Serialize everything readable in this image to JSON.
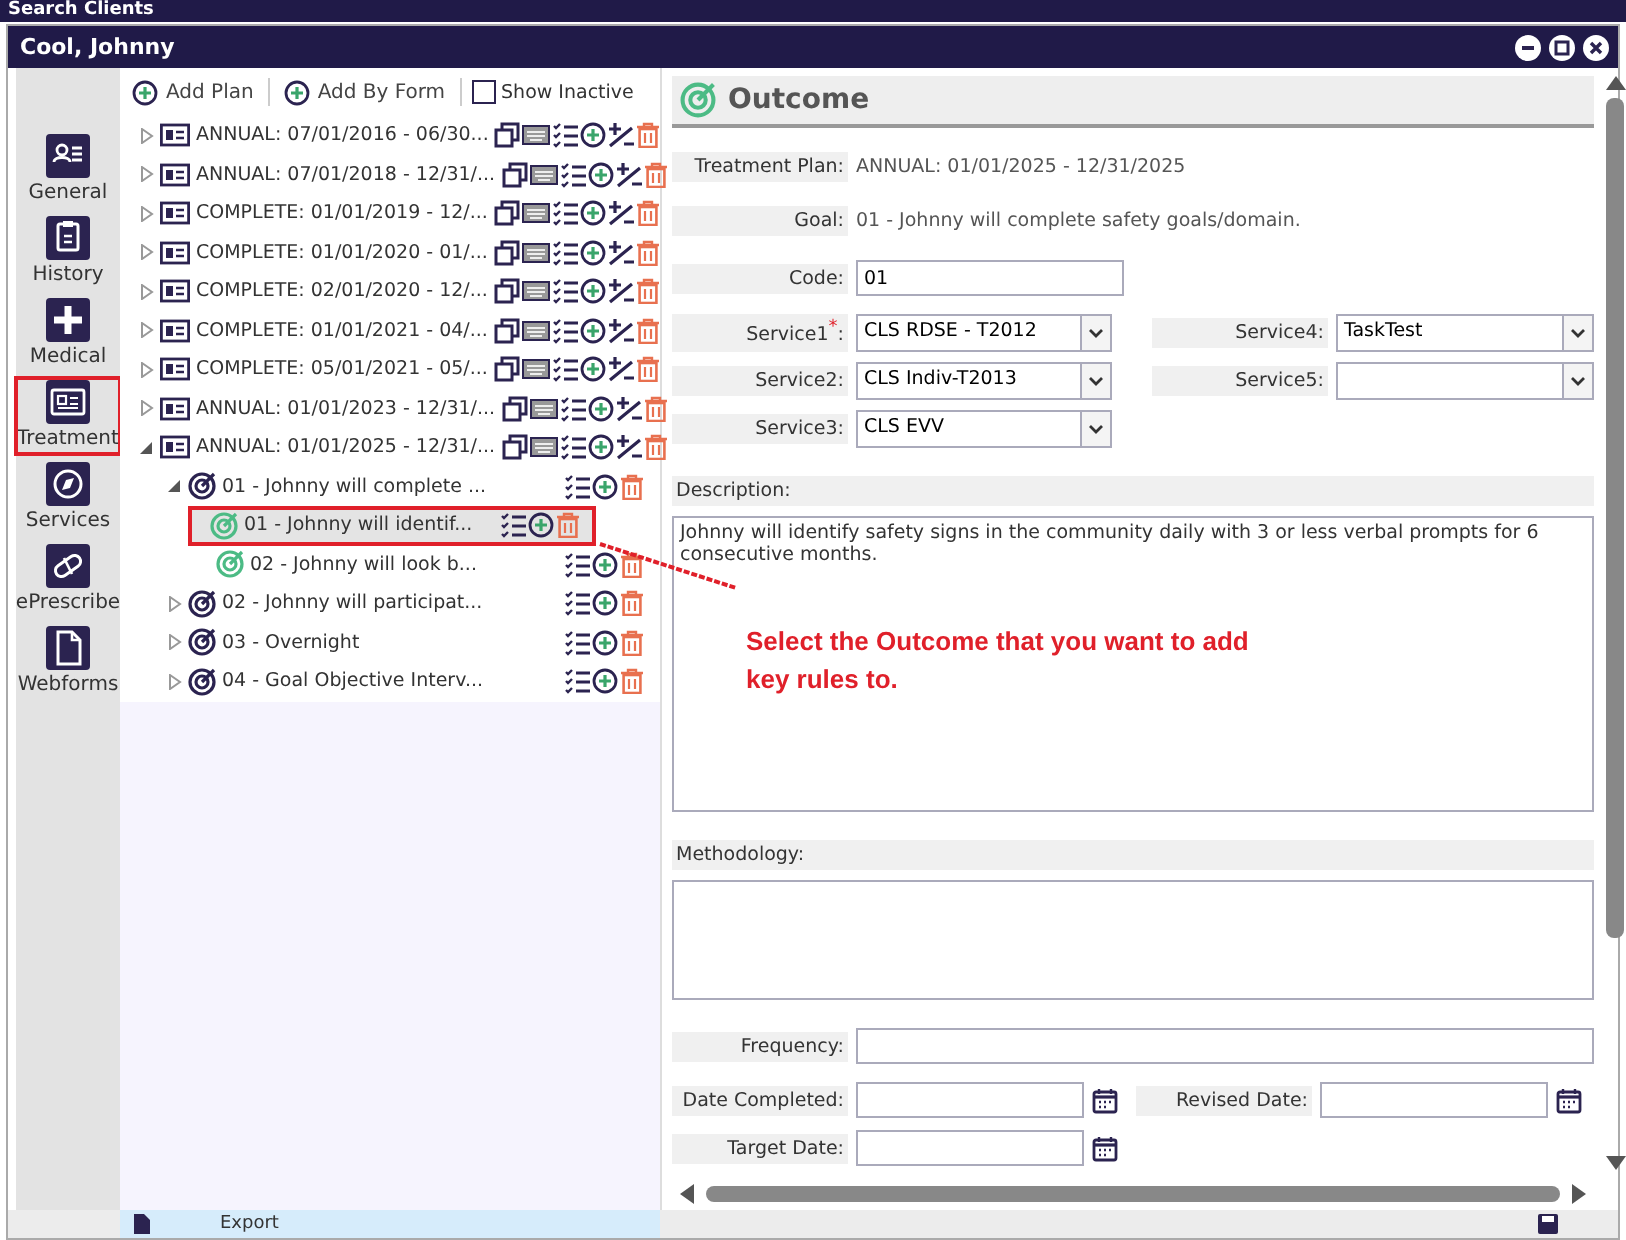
{
  "top_bar": {
    "title": "Search Clients"
  },
  "window": {
    "title": "Cool, Johnny"
  },
  "nav": [
    {
      "label": "General",
      "selected": false
    },
    {
      "label": "History",
      "selected": false
    },
    {
      "label": "Medical",
      "selected": false
    },
    {
      "label": "Treatment",
      "selected": true
    },
    {
      "label": "Services",
      "selected": false
    },
    {
      "label": "ePrescribe",
      "selected": false
    },
    {
      "label": "Webforms",
      "selected": false
    }
  ],
  "toolbar": {
    "add_plan": "Add Plan",
    "add_by_form": "Add By Form",
    "show_inactive": {
      "label": "Show Inactive",
      "checked": false
    }
  },
  "tree": [
    {
      "kind": "plan",
      "label": "ANNUAL: 07/01/2016 - 06/30...",
      "expanded": false,
      "selected": false
    },
    {
      "kind": "plan",
      "label": "ANNUAL: 07/01/2018 - 12/31/...",
      "expanded": false,
      "selected": false
    },
    {
      "kind": "plan",
      "label": "COMPLETE: 01/01/2019 - 12/...",
      "expanded": false,
      "selected": false
    },
    {
      "kind": "plan",
      "label": "COMPLETE: 01/01/2020 - 01/...",
      "expanded": false,
      "selected": false
    },
    {
      "kind": "plan",
      "label": "COMPLETE: 02/01/2020 - 12/...",
      "expanded": false,
      "selected": false
    },
    {
      "kind": "plan",
      "label": "COMPLETE: 01/01/2021 - 04/...",
      "expanded": false,
      "selected": false
    },
    {
      "kind": "plan",
      "label": "COMPLETE: 05/01/2021 - 05/...",
      "expanded": false,
      "selected": false
    },
    {
      "kind": "plan",
      "label": "ANNUAL: 01/01/2023 - 12/31/...",
      "expanded": false,
      "selected": false
    },
    {
      "kind": "plan",
      "label": "ANNUAL: 01/01/2025 - 12/31/...",
      "expanded": true,
      "selected": false,
      "children": [
        {
          "kind": "goal",
          "label": "01 - Johnny will complete ...",
          "expanded": true,
          "selected": false,
          "children": [
            {
              "kind": "outcome",
              "label": "01 - Johnny will identif...",
              "selected": true
            },
            {
              "kind": "outcome",
              "label": "02 - Johnny will look b...",
              "selected": false
            }
          ]
        },
        {
          "kind": "goal",
          "label": "02 - Johnny will participat...",
          "expanded": false,
          "selected": false
        },
        {
          "kind": "goal",
          "label": "03 - Overnight",
          "expanded": false,
          "selected": false
        },
        {
          "kind": "goal",
          "label": "04 - Goal Objective Interv...",
          "expanded": false,
          "selected": false
        }
      ]
    }
  ],
  "form": {
    "title": "Outcome",
    "treatment_plan": {
      "label": "Treatment Plan:",
      "value": "ANNUAL: 01/01/2025 - 12/31/2025"
    },
    "goal": {
      "label": "Goal:",
      "value": "01 - Johnny will complete safety goals/domain."
    },
    "code": {
      "label": "Code:",
      "value": "01"
    },
    "services": [
      {
        "label": "Service1$^{*}$:",
        "value": "CLS RDSE - T2012"
      },
      {
        "label": "Service2:",
        "value": "CLS Indiv-T2013"
      },
      {
        "label": "Service3:",
        "value": "CLS EVV"
      },
      {
        "label": "Service4:",
        "value": "TaskTest"
      },
      {
        "label": "Service5:"
      }
    ],
    "description": {
      "label": "Description:",
      "value": "Johnny will identify safety signs in the community daily with 3 or less verbal prompts for 6 consecutive months."
    },
    "methodology": {
      "label": "Methodology:"
    },
    "frequency": {
      "label": "Frequency:"
    },
    "date_completed": {
      "label": "Date Completed:"
    },
    "revised_date": {
      "label": "Revised Date:"
    },
    "target_date": {
      "label": "Target Date:"
    }
  },
  "footer": {
    "export": "Export"
  },
  "annotation": {
    "text": "Select the Outcome that you want to add key rules to."
  }
}
